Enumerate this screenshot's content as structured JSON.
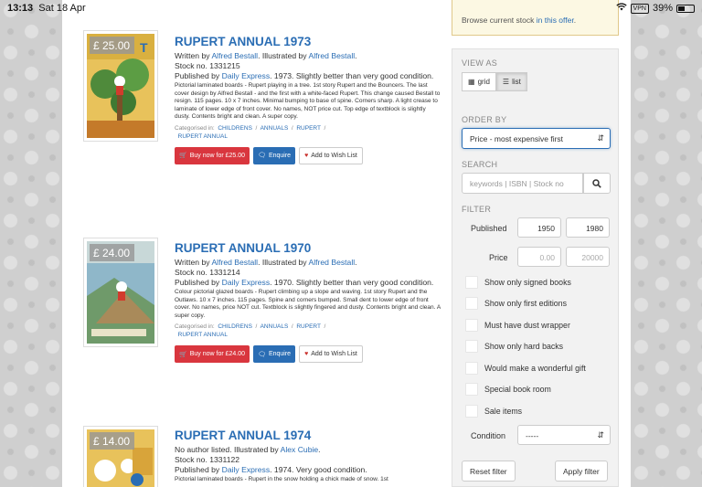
{
  "status": {
    "time": "13:13",
    "date": "Sat 18 Apr",
    "vpn": "VPN",
    "battery": "39%"
  },
  "offer_notice": {
    "text": "Browse current stock ",
    "link": "in this offer",
    "end": "."
  },
  "listings": [
    {
      "price": "£ 25.00",
      "title": "RUPERT ANNUAL 1973",
      "written_prefix": "Written by ",
      "author": "Alfred Bestall",
      "illustrated_prefix": ". Illustrated by ",
      "illustrator": "Alfred Bestall",
      "illustrated_end": ".",
      "stock": "Stock no. 1331215",
      "pub_prefix": "Published by ",
      "publisher": "Daily Express",
      "pub_rest": ". 1973. Slightly better than very good condition.",
      "description": "Pictorial laminated boards - Rupert playing in a tree. 1st story Rupert and the Bouncers. The last cover design by Alfred Bestall - and the first with a white-faced Rupert. This change caused Bestall to resign. 115 pages. 10 x 7 inches. Minimal bumping to base of spine. Corners sharp. A light crease to laminate of lower edge of front cover. No names, NOT price cut. Top edge of textblock is slightly dusty. Contents bright and clean. A super copy.",
      "categorised": "Categorised in:",
      "cats": [
        "CHILDRENS",
        "ANNUALS",
        "RUPERT",
        "RUPERT ANNUAL"
      ],
      "buy": "Buy now for £25.00",
      "enquire": "Enquire",
      "wish": "Add to Wish List"
    },
    {
      "price": "£ 24.00",
      "title": "RUPERT ANNUAL 1970",
      "written_prefix": "Written by ",
      "author": "Alfred Bestall",
      "illustrated_prefix": ". Illustrated by ",
      "illustrator": "Alfred Bestall",
      "illustrated_end": ".",
      "stock": "Stock no. 1331214",
      "pub_prefix": "Published by ",
      "publisher": "Daily Express",
      "pub_rest": ". 1970. Slightly better than very good condition.",
      "description": "Colour pictorial glazed boards - Rupert climbing up a slope and waving. 1st story Rupert and the Outlaws. 10 x 7 inches. 115 pages. Spine and corners bumped. Small dent to lower edge of front cover. No names, price NOT cut. Textblock is slightly fingered and dusty. Contents bright and clean. A super copy.",
      "categorised": "Categorised in:",
      "cats": [
        "CHILDRENS",
        "ANNUALS",
        "RUPERT",
        "RUPERT ANNUAL"
      ],
      "buy": "Buy now for £24.00",
      "enquire": "Enquire",
      "wish": "Add to Wish List"
    },
    {
      "price": "£ 14.00",
      "title": "RUPERT ANNUAL 1974",
      "author_line_prefix": "No author listed. Illustrated by ",
      "illustrator": "Alex Cubie",
      "illustrated_end": ".",
      "stock": "Stock no. 1331122",
      "pub_prefix": "Published by ",
      "publisher": "Daily Express",
      "pub_rest": ". 1974. Very good condition.",
      "description": "Pictorial laminated boards - Rupert in the snow holding a chick made of snow. 1st"
    }
  ],
  "sidebar": {
    "view_as": "VIEW AS",
    "grid": "grid",
    "list": "list",
    "order_by": "ORDER BY",
    "order_value": "Price - most expensive first",
    "search": "SEARCH",
    "search_placeholder": "keywords | ISBN | Stock no",
    "filter": "FILTER",
    "published_label": "Published",
    "published_from": "1950",
    "published_to": "1980",
    "price_label": "Price",
    "price_from": "0.00",
    "price_to": "20000",
    "checkboxes": [
      "Show only signed books",
      "Show only first editions",
      "Must have dust wrapper",
      "Show only hard backs",
      "Would make a wonderful gift",
      "Special book room",
      "Sale items"
    ],
    "condition_label": "Condition",
    "condition_value": "-----",
    "reset": "Reset filter",
    "apply": "Apply filter"
  }
}
